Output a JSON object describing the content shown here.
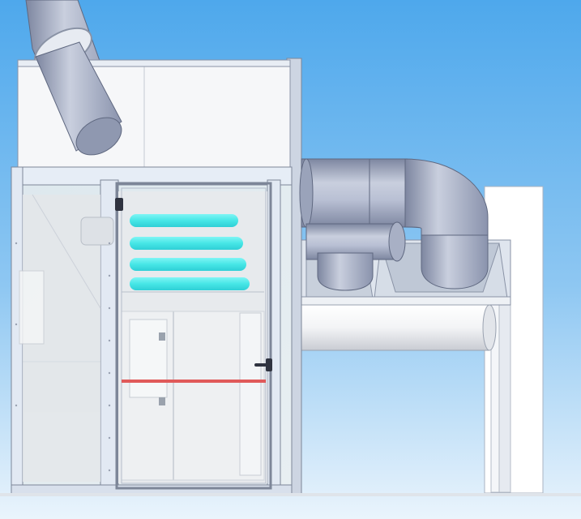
{
  "scene": {
    "kind": "3d-cad-render",
    "subject": "booth-with-glass-doors-and-ductwork",
    "colors": {
      "sky_top": "#4ea8ec",
      "sky_bottom": "#eaf4fc",
      "duct": "#b9c0d4",
      "duct_shade": "#7d86a0",
      "frame": "#e9eef6",
      "glass": "#cfe6f2",
      "light_bar": "#46e6e6",
      "red_beam": "#e05a5a",
      "wall": "#ffffff"
    },
    "icons": [
      "door-handle-icon",
      "hinge-icon"
    ]
  }
}
